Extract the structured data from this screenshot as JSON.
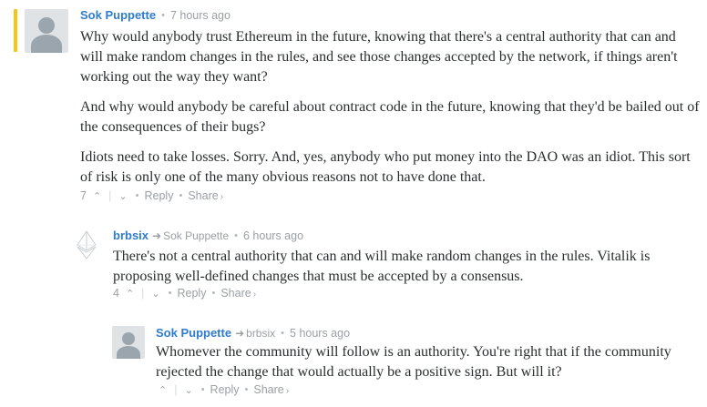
{
  "comments": [
    {
      "author": "Sok Puppette",
      "time": "7 hours ago",
      "paragraphs": [
        "Why would anybody trust Ethereum in the future, knowing that there's a central authority that can and will make random changes in the rules, and see those changes accepted by the network, if things aren't working out the way they want?",
        "And why would anybody be careful about contract code in the future, knowing that they'd be bailed out of the consequences of their bugs?",
        "Idiots need to take losses. Sorry. And, yes, anybody who put money into the DAO was an idiot. This sort of risk is only one of the many obvious reasons not to have done that."
      ],
      "votes": "7",
      "reply_label": "Reply",
      "share_label": "Share"
    },
    {
      "author": "brbsix",
      "reply_to": "Sok Puppette",
      "time": "6 hours ago",
      "paragraphs": [
        "There's not a central authority that can and will make random changes in the rules. Vitalik is proposing well-defined changes that must be accepted by a consensus."
      ],
      "votes": "4",
      "reply_label": "Reply",
      "share_label": "Share"
    },
    {
      "author": "Sok Puppette",
      "reply_to": "brbsix",
      "time": "5 hours ago",
      "paragraphs": [
        "Whomever the community will follow is an authority. You're right that if the community rejected the change that would actually be a positive sign. But will it?"
      ],
      "votes": "",
      "reply_label": "Reply",
      "share_label": "Share"
    }
  ],
  "icons": {
    "upvote": "chevron-up-icon",
    "downvote": "chevron-down-icon",
    "reply_arrow": "reply-arrow-icon",
    "share_chevron": "chevron-right-icon",
    "eth_avatar": "ethereum-logo-icon"
  },
  "colors": {
    "author": "#2f7ccd",
    "highlight": "#f5c518",
    "text": "#2a2e2e",
    "meta": "#9aa0a6"
  }
}
